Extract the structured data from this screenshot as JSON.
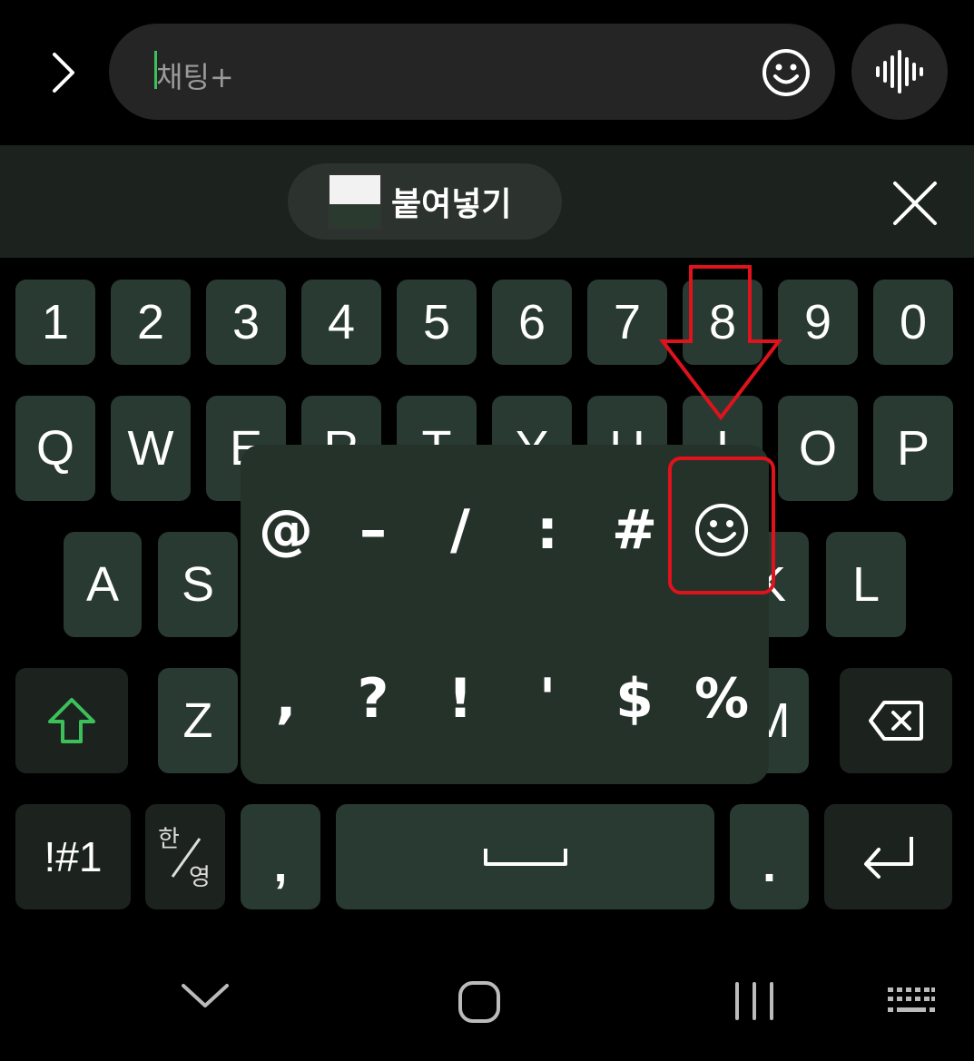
{
  "chat_bar": {
    "placeholder": "채팅+"
  },
  "toolbar": {
    "paste_label": "붙여넣기"
  },
  "keyboard": {
    "number_row": [
      "1",
      "2",
      "3",
      "4",
      "5",
      "6",
      "7",
      "8",
      "9",
      "0"
    ],
    "row_q": [
      "Q",
      "W",
      "E",
      "R",
      "T",
      "Y",
      "U",
      "I",
      "O",
      "P"
    ],
    "row_a_visible": [
      "A",
      "S",
      "K",
      "L"
    ],
    "row_z_visible": [
      "Z",
      "M"
    ],
    "symbols_key": "!#1",
    "lang_key_top": "한",
    "lang_key_bottom": "영",
    "comma_key": ",",
    "period_key": "."
  },
  "popup": {
    "row1": [
      "@",
      "–",
      "/",
      ":",
      "#"
    ],
    "row2": [
      ",",
      "?",
      "!",
      "'",
      "$",
      "%"
    ]
  },
  "colors": {
    "accent_green": "#3cc15a",
    "key_bg": "#293a32",
    "annotation_red": "#e0121c"
  }
}
